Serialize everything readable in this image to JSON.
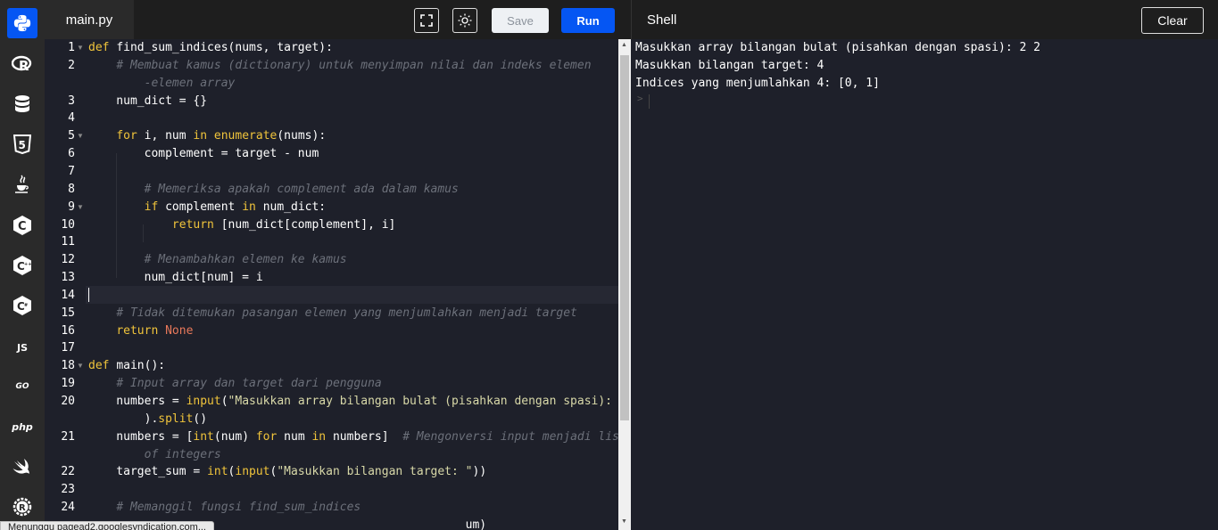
{
  "editor": {
    "file_tab": "main.py",
    "save_label": "Save",
    "run_label": "Run",
    "lines": [
      {
        "n": "1",
        "fold": true,
        "segs": [
          [
            "kw",
            "def "
          ],
          [
            "",
            "find_sum_indices(nums, target):"
          ]
        ]
      },
      {
        "n": "2",
        "fold": false,
        "segs": [
          [
            "",
            "    "
          ],
          [
            "cm",
            "# Membuat kamus (dictionary) untuk menyimpan nilai dan indeks elemen"
          ]
        ]
      },
      {
        "n": "",
        "fold": false,
        "segs": [
          [
            "",
            "        "
          ],
          [
            "cm",
            "-elemen array"
          ]
        ]
      },
      {
        "n": "3",
        "fold": false,
        "segs": [
          [
            "",
            "    num_dict = {}"
          ]
        ]
      },
      {
        "n": "4",
        "fold": false,
        "segs": []
      },
      {
        "n": "5",
        "fold": true,
        "segs": [
          [
            "",
            "    "
          ],
          [
            "kw",
            "for "
          ],
          [
            "",
            "i, num "
          ],
          [
            "kw",
            "in "
          ],
          [
            "kw",
            "enumerate"
          ],
          [
            "",
            "(nums):"
          ]
        ]
      },
      {
        "n": "6",
        "fold": false,
        "segs": [
          [
            "",
            "        complement = target - num"
          ]
        ]
      },
      {
        "n": "7",
        "fold": false,
        "segs": []
      },
      {
        "n": "8",
        "fold": false,
        "segs": [
          [
            "",
            "        "
          ],
          [
            "cm",
            "# Memeriksa apakah complement ada dalam kamus"
          ]
        ]
      },
      {
        "n": "9",
        "fold": true,
        "segs": [
          [
            "",
            "        "
          ],
          [
            "kw",
            "if "
          ],
          [
            "",
            "complement "
          ],
          [
            "kw",
            "in "
          ],
          [
            "",
            "num_dict:"
          ]
        ]
      },
      {
        "n": "10",
        "fold": false,
        "segs": [
          [
            "",
            "            "
          ],
          [
            "kw",
            "return "
          ],
          [
            "",
            "[num_dict[complement], i]"
          ]
        ]
      },
      {
        "n": "11",
        "fold": false,
        "segs": []
      },
      {
        "n": "12",
        "fold": false,
        "segs": [
          [
            "",
            "        "
          ],
          [
            "cm",
            "# Menambahkan elemen ke kamus"
          ]
        ]
      },
      {
        "n": "13",
        "fold": false,
        "segs": [
          [
            "",
            "        num_dict[num] = i"
          ]
        ]
      },
      {
        "n": "14",
        "fold": false,
        "segs": []
      },
      {
        "n": "15",
        "fold": false,
        "segs": [
          [
            "",
            "    "
          ],
          [
            "cm",
            "# Tidak ditemukan pasangan elemen yang menjumlahkan menjadi target"
          ]
        ]
      },
      {
        "n": "16",
        "fold": false,
        "segs": [
          [
            "",
            "    "
          ],
          [
            "kw",
            "return "
          ],
          [
            "nn",
            "None"
          ]
        ]
      },
      {
        "n": "17",
        "fold": false,
        "segs": []
      },
      {
        "n": "18",
        "fold": true,
        "segs": [
          [
            "kw",
            "def "
          ],
          [
            "",
            "main():"
          ]
        ]
      },
      {
        "n": "19",
        "fold": false,
        "segs": [
          [
            "",
            "    "
          ],
          [
            "cm",
            "# Input array dan target dari pengguna"
          ]
        ]
      },
      {
        "n": "20",
        "fold": false,
        "segs": [
          [
            "",
            "    numbers = "
          ],
          [
            "kw",
            "input"
          ],
          [
            "",
            "("
          ],
          [
            "st",
            "\"Masukkan array bilangan bulat (pisahkan dengan spasi): \""
          ]
        ]
      },
      {
        "n": "",
        "fold": false,
        "segs": [
          [
            "",
            "        )."
          ],
          [
            "kw",
            "split"
          ],
          [
            "",
            "()"
          ]
        ]
      },
      {
        "n": "21",
        "fold": false,
        "segs": [
          [
            "",
            "    numbers = ["
          ],
          [
            "kw",
            "int"
          ],
          [
            "",
            "(num) "
          ],
          [
            "kw",
            "for "
          ],
          [
            "",
            "num "
          ],
          [
            "kw",
            "in "
          ],
          [
            "",
            "numbers]  "
          ],
          [
            "cm",
            "# Mengonversi input menjadi list"
          ]
        ]
      },
      {
        "n": "",
        "fold": false,
        "segs": [
          [
            "",
            "        "
          ],
          [
            "cm",
            "of integers"
          ]
        ]
      },
      {
        "n": "22",
        "fold": false,
        "segs": [
          [
            "",
            "    target_sum = "
          ],
          [
            "kw",
            "int"
          ],
          [
            "",
            "("
          ],
          [
            "kw",
            "input"
          ],
          [
            "",
            "("
          ],
          [
            "st",
            "\"Masukkan bilangan target: \""
          ],
          [
            "",
            "))"
          ]
        ]
      },
      {
        "n": "23",
        "fold": false,
        "segs": []
      },
      {
        "n": "24",
        "fold": false,
        "segs": [
          [
            "",
            "    "
          ],
          [
            "cm",
            "# Memanggil fungsi find_sum_indices"
          ]
        ]
      },
      {
        "n": "",
        "fold": false,
        "segs": [
          [
            "",
            "                                                      um)"
          ]
        ]
      }
    ]
  },
  "shell": {
    "title": "Shell",
    "clear_label": "Clear",
    "output": [
      "Masukkan array bilangan bulat (pisahkan dengan spasi): 2 2",
      "Masukkan bilangan target: 4",
      "Indices yang menjumlahkan 4: [0, 1]"
    ],
    "prompt": ">"
  },
  "sidebar": {
    "items": [
      {
        "name": "python",
        "label": "",
        "active": true
      },
      {
        "name": "r",
        "label": "R",
        "active": false
      },
      {
        "name": "sql",
        "label": "",
        "active": false
      },
      {
        "name": "html",
        "label": "5",
        "active": false
      },
      {
        "name": "java",
        "label": "",
        "active": false
      },
      {
        "name": "c",
        "label": "C",
        "active": false
      },
      {
        "name": "cpp",
        "label": "C",
        "active": false
      },
      {
        "name": "csharp",
        "label": "C",
        "active": false
      },
      {
        "name": "javascript",
        "label": "JS",
        "active": false
      },
      {
        "name": "go",
        "label": "GO",
        "active": false
      },
      {
        "name": "php",
        "label": "php",
        "active": false
      },
      {
        "name": "swift",
        "label": "",
        "active": false
      },
      {
        "name": "rust",
        "label": "R",
        "active": false
      }
    ]
  },
  "status_url": "Menunggu pagead2.googlesyndication.com..."
}
